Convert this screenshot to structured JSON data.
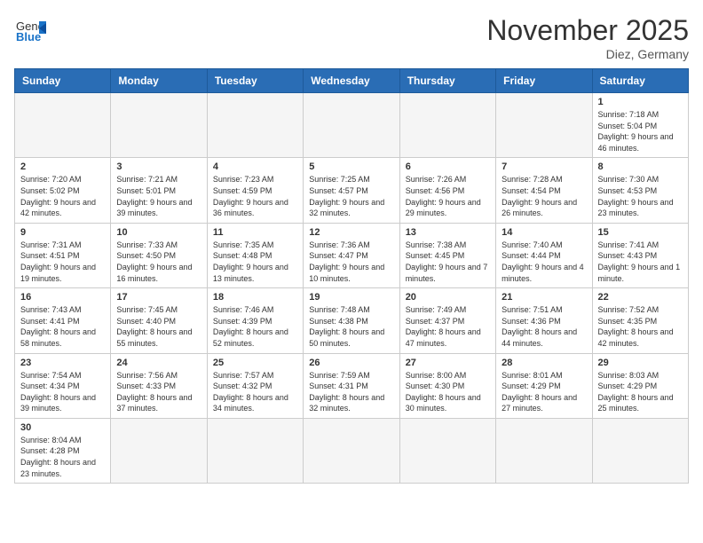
{
  "header": {
    "logo_general": "General",
    "logo_blue": "Blue",
    "month_title": "November 2025",
    "location": "Diez, Germany"
  },
  "weekdays": [
    "Sunday",
    "Monday",
    "Tuesday",
    "Wednesday",
    "Thursday",
    "Friday",
    "Saturday"
  ],
  "days": [
    {
      "date": "",
      "info": ""
    },
    {
      "date": "",
      "info": ""
    },
    {
      "date": "",
      "info": ""
    },
    {
      "date": "",
      "info": ""
    },
    {
      "date": "",
      "info": ""
    },
    {
      "date": "",
      "info": ""
    },
    {
      "date": "1",
      "info": "Sunrise: 7:18 AM\nSunset: 5:04 PM\nDaylight: 9 hours\nand 46 minutes."
    },
    {
      "date": "2",
      "info": "Sunrise: 7:20 AM\nSunset: 5:02 PM\nDaylight: 9 hours\nand 42 minutes."
    },
    {
      "date": "3",
      "info": "Sunrise: 7:21 AM\nSunset: 5:01 PM\nDaylight: 9 hours\nand 39 minutes."
    },
    {
      "date": "4",
      "info": "Sunrise: 7:23 AM\nSunset: 4:59 PM\nDaylight: 9 hours\nand 36 minutes."
    },
    {
      "date": "5",
      "info": "Sunrise: 7:25 AM\nSunset: 4:57 PM\nDaylight: 9 hours\nand 32 minutes."
    },
    {
      "date": "6",
      "info": "Sunrise: 7:26 AM\nSunset: 4:56 PM\nDaylight: 9 hours\nand 29 minutes."
    },
    {
      "date": "7",
      "info": "Sunrise: 7:28 AM\nSunset: 4:54 PM\nDaylight: 9 hours\nand 26 minutes."
    },
    {
      "date": "8",
      "info": "Sunrise: 7:30 AM\nSunset: 4:53 PM\nDaylight: 9 hours\nand 23 minutes."
    },
    {
      "date": "9",
      "info": "Sunrise: 7:31 AM\nSunset: 4:51 PM\nDaylight: 9 hours\nand 19 minutes."
    },
    {
      "date": "10",
      "info": "Sunrise: 7:33 AM\nSunset: 4:50 PM\nDaylight: 9 hours\nand 16 minutes."
    },
    {
      "date": "11",
      "info": "Sunrise: 7:35 AM\nSunset: 4:48 PM\nDaylight: 9 hours\nand 13 minutes."
    },
    {
      "date": "12",
      "info": "Sunrise: 7:36 AM\nSunset: 4:47 PM\nDaylight: 9 hours\nand 10 minutes."
    },
    {
      "date": "13",
      "info": "Sunrise: 7:38 AM\nSunset: 4:45 PM\nDaylight: 9 hours\nand 7 minutes."
    },
    {
      "date": "14",
      "info": "Sunrise: 7:40 AM\nSunset: 4:44 PM\nDaylight: 9 hours\nand 4 minutes."
    },
    {
      "date": "15",
      "info": "Sunrise: 7:41 AM\nSunset: 4:43 PM\nDaylight: 9 hours\nand 1 minute."
    },
    {
      "date": "16",
      "info": "Sunrise: 7:43 AM\nSunset: 4:41 PM\nDaylight: 8 hours\nand 58 minutes."
    },
    {
      "date": "17",
      "info": "Sunrise: 7:45 AM\nSunset: 4:40 PM\nDaylight: 8 hours\nand 55 minutes."
    },
    {
      "date": "18",
      "info": "Sunrise: 7:46 AM\nSunset: 4:39 PM\nDaylight: 8 hours\nand 52 minutes."
    },
    {
      "date": "19",
      "info": "Sunrise: 7:48 AM\nSunset: 4:38 PM\nDaylight: 8 hours\nand 50 minutes."
    },
    {
      "date": "20",
      "info": "Sunrise: 7:49 AM\nSunset: 4:37 PM\nDaylight: 8 hours\nand 47 minutes."
    },
    {
      "date": "21",
      "info": "Sunrise: 7:51 AM\nSunset: 4:36 PM\nDaylight: 8 hours\nand 44 minutes."
    },
    {
      "date": "22",
      "info": "Sunrise: 7:52 AM\nSunset: 4:35 PM\nDaylight: 8 hours\nand 42 minutes."
    },
    {
      "date": "23",
      "info": "Sunrise: 7:54 AM\nSunset: 4:34 PM\nDaylight: 8 hours\nand 39 minutes."
    },
    {
      "date": "24",
      "info": "Sunrise: 7:56 AM\nSunset: 4:33 PM\nDaylight: 8 hours\nand 37 minutes."
    },
    {
      "date": "25",
      "info": "Sunrise: 7:57 AM\nSunset: 4:32 PM\nDaylight: 8 hours\nand 34 minutes."
    },
    {
      "date": "26",
      "info": "Sunrise: 7:59 AM\nSunset: 4:31 PM\nDaylight: 8 hours\nand 32 minutes."
    },
    {
      "date": "27",
      "info": "Sunrise: 8:00 AM\nSunset: 4:30 PM\nDaylight: 8 hours\nand 30 minutes."
    },
    {
      "date": "28",
      "info": "Sunrise: 8:01 AM\nSunset: 4:29 PM\nDaylight: 8 hours\nand 27 minutes."
    },
    {
      "date": "29",
      "info": "Sunrise: 8:03 AM\nSunset: 4:29 PM\nDaylight: 8 hours\nand 25 minutes."
    },
    {
      "date": "30",
      "info": "Sunrise: 8:04 AM\nSunset: 4:28 PM\nDaylight: 8 hours\nand 23 minutes."
    },
    {
      "date": "",
      "info": ""
    },
    {
      "date": "",
      "info": ""
    },
    {
      "date": "",
      "info": ""
    },
    {
      "date": "",
      "info": ""
    },
    {
      "date": "",
      "info": ""
    },
    {
      "date": "",
      "info": ""
    }
  ]
}
